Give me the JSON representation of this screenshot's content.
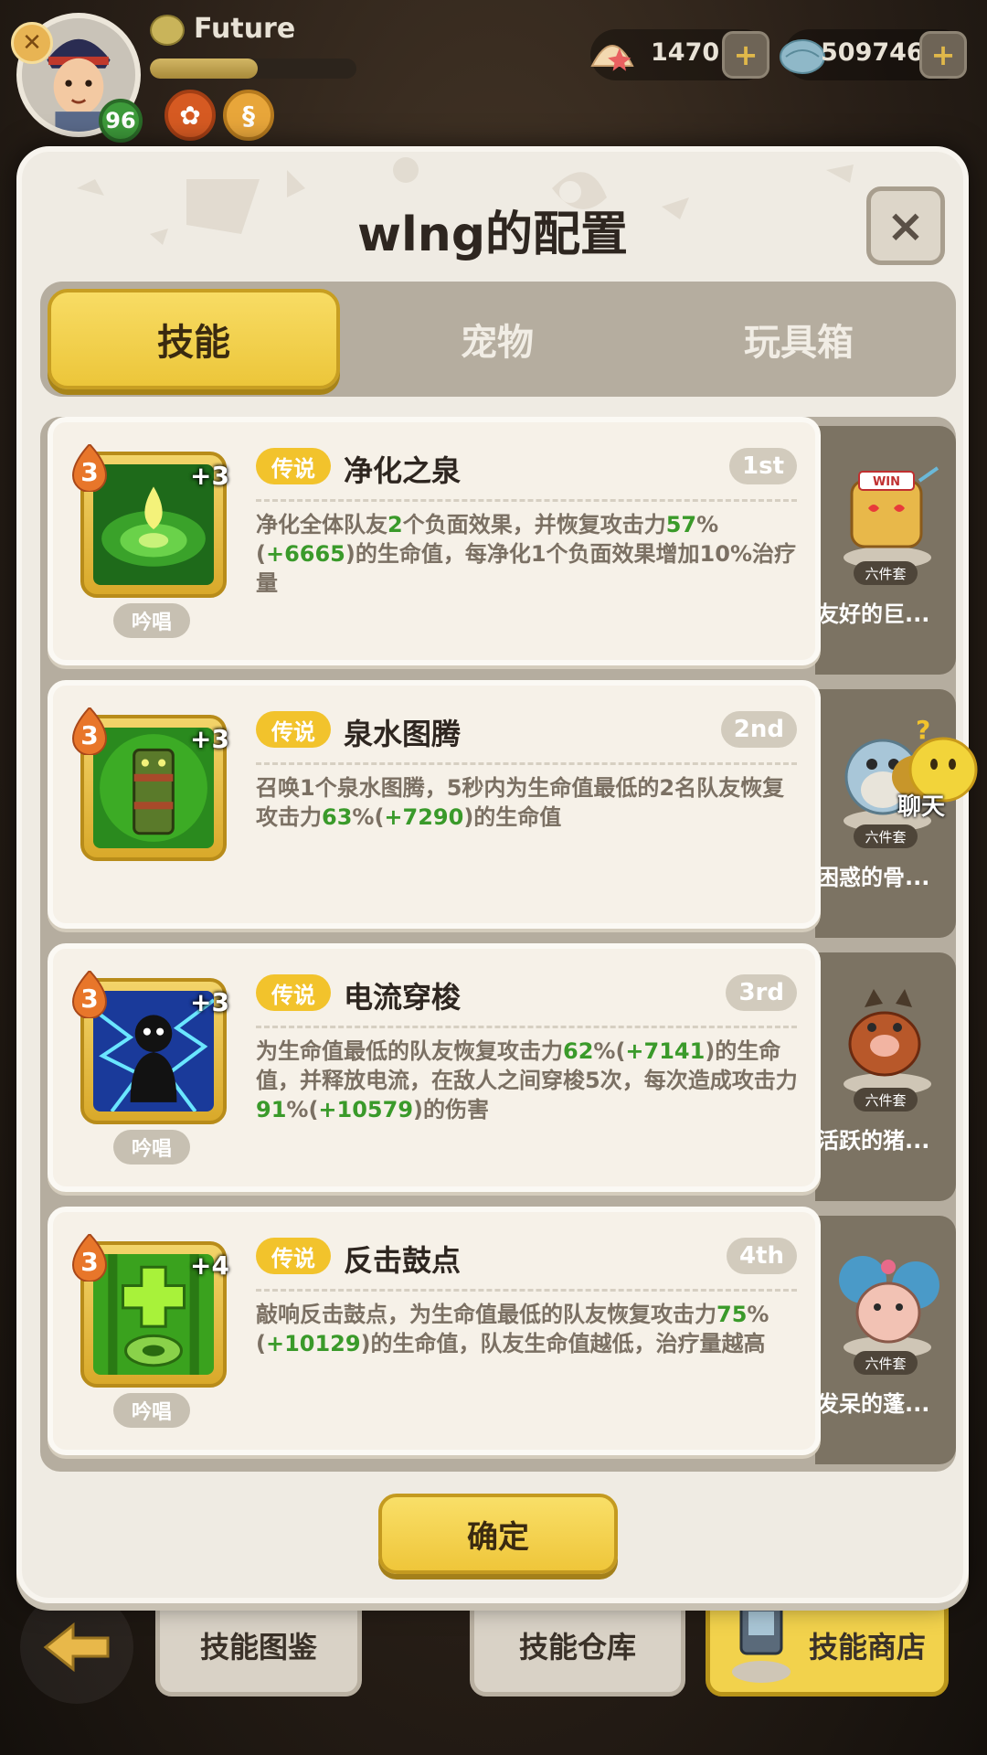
{
  "hud": {
    "player_name": "Future",
    "player_level": "96",
    "exp_fraction": 0.52,
    "currency_1": "1470",
    "currency_2": "509746",
    "plus_label": "+"
  },
  "dialog": {
    "title": "wlng的配置",
    "close_label": "×",
    "tabs": [
      {
        "label": "技能",
        "active": true
      },
      {
        "label": "宠物",
        "active": false
      },
      {
        "label": "玩具箱",
        "active": false
      }
    ],
    "confirm_label": "确定"
  },
  "skills": [
    {
      "level": "3",
      "plus": "+3",
      "chant": "吟唱",
      "rarity": "传说",
      "name": "净化之泉",
      "rank": "1st",
      "desc_parts": [
        {
          "t": "净化全体队友",
          "g": false
        },
        {
          "t": "2",
          "g": true
        },
        {
          "t": "个负面效果，并恢复攻击力",
          "g": false
        },
        {
          "t": "57",
          "g": true
        },
        {
          "t": "%(",
          "g": false
        },
        {
          "t": "+6665",
          "g": true
        },
        {
          "t": ")的生命值，每净化1个负面效果增加10%治疗量",
          "g": false
        }
      ],
      "pet_name": "友好的巨...",
      "pet_set": "六件套"
    },
    {
      "level": "3",
      "plus": "+3",
      "chant": "",
      "rarity": "传说",
      "name": "泉水图腾",
      "rank": "2nd",
      "desc_parts": [
        {
          "t": "召唤1个泉水图腾，5秒内为生命值最低的2名队友恢复攻击力",
          "g": false
        },
        {
          "t": "63",
          "g": true
        },
        {
          "t": "%(",
          "g": false
        },
        {
          "t": "+7290",
          "g": true
        },
        {
          "t": ")的生命值",
          "g": false
        }
      ],
      "pet_name": "困惑的骨...",
      "pet_set": "六件套"
    },
    {
      "level": "3",
      "plus": "+3",
      "chant": "吟唱",
      "rarity": "传说",
      "name": "电流穿梭",
      "rank": "3rd",
      "desc_parts": [
        {
          "t": "为生命值最低的队友恢复攻击力",
          "g": false
        },
        {
          "t": "62",
          "g": true
        },
        {
          "t": "%(",
          "g": false
        },
        {
          "t": "+7141",
          "g": true
        },
        {
          "t": ")的生命值，并释放电流，在敌人之间穿梭5次，每次造成攻击力",
          "g": false
        },
        {
          "t": "91",
          "g": true
        },
        {
          "t": "%(",
          "g": false
        },
        {
          "t": "+10579",
          "g": true
        },
        {
          "t": ")的伤害",
          "g": false
        }
      ],
      "pet_name": "活跃的猪...",
      "pet_set": "六件套"
    },
    {
      "level": "3",
      "plus": "+4",
      "chant": "吟唱",
      "rarity": "传说",
      "name": "反击鼓点",
      "rank": "4th",
      "desc_parts": [
        {
          "t": "敲响反击鼓点，为生命值最低的队友恢复攻击力",
          "g": false
        },
        {
          "t": "75",
          "g": true
        },
        {
          "t": "%(",
          "g": false
        },
        {
          "t": "+10129",
          "g": true
        },
        {
          "t": ")的生命值，队友生命值越低，治疗量越高",
          "g": false
        }
      ],
      "pet_name": "发呆的蓬...",
      "pet_set": "六件套"
    }
  ],
  "bottom": {
    "btn_1": "技能图鉴",
    "btn_2": "技能仓库",
    "btn_3": "技能商店"
  },
  "chat_label": "聊天",
  "colors": {
    "accent_yellow": "#f2c32c",
    "value_green": "#3a9a2a",
    "tab_bg": "#b5ad9f",
    "card_bg": "#f6f1e8"
  },
  "icons": {
    "skill_1": "green-spring-drop-icon",
    "skill_2": "totem-icon",
    "skill_3": "lightning-figure-icon",
    "skill_4": "drum-cross-icon"
  }
}
